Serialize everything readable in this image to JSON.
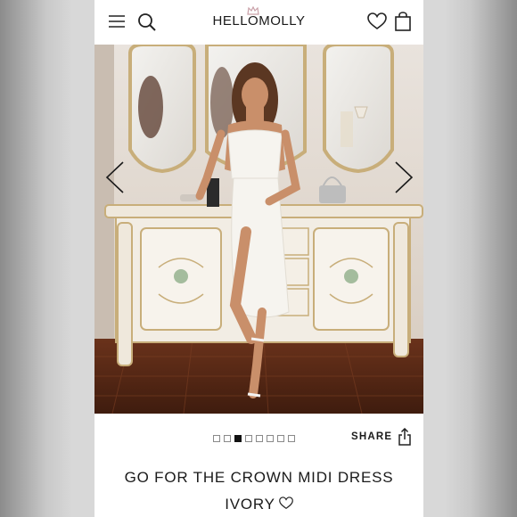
{
  "header": {
    "brand": "HELLOMOLLY",
    "icons": [
      "menu-icon",
      "search-icon",
      "heart-icon",
      "shopping-bag-icon",
      "crown-icon"
    ]
  },
  "gallery": {
    "total_images": 8,
    "active_index": 3,
    "share_label": "SHARE"
  },
  "product": {
    "title": "GO FOR THE CROWN MIDI DRESS",
    "color": "IVORY"
  },
  "colors": {
    "text": "#1a1a1a",
    "dress": "#f6f4ef",
    "floor": "#5a2a17"
  }
}
